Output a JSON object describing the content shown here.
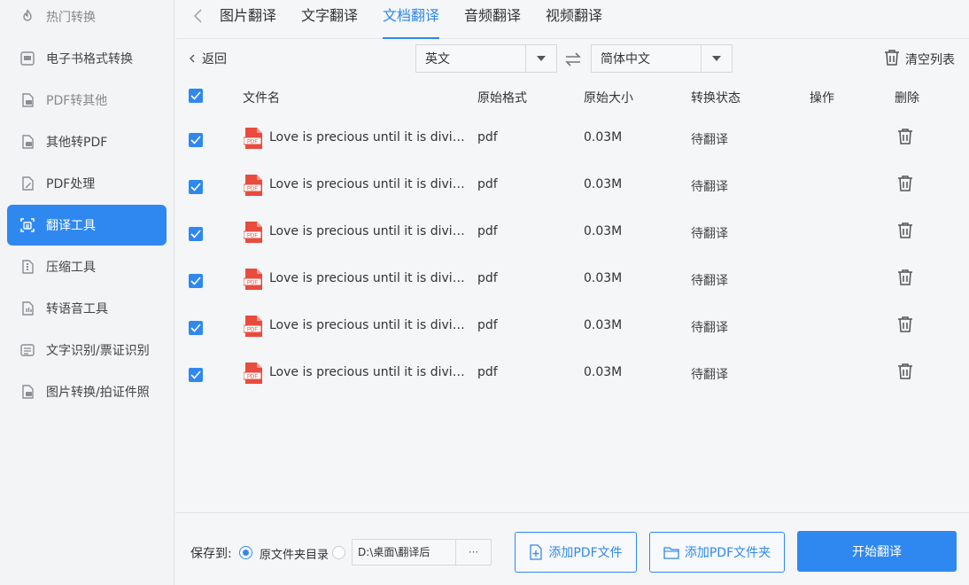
{
  "sidebar": {
    "items": [
      {
        "label": "热门转换",
        "icon": "flame-icon"
      },
      {
        "label": "电子书格式转换",
        "icon": "ebook-icon"
      },
      {
        "label": "PDF转其他",
        "icon": "pdf-convert-icon"
      },
      {
        "label": "其他转PDF",
        "icon": "to-pdf-icon"
      },
      {
        "label": "PDF处理",
        "icon": "pdf-edit-icon"
      },
      {
        "label": "翻译工具",
        "icon": "translate-icon",
        "active": true
      },
      {
        "label": "压缩工具",
        "icon": "compress-icon"
      },
      {
        "label": "转语音工具",
        "icon": "audio-icon"
      },
      {
        "label": "文字识别/票证识别",
        "icon": "ocr-icon"
      },
      {
        "label": "图片转换/拍证件照",
        "icon": "image-convert-icon"
      }
    ]
  },
  "tabs": [
    {
      "label": "图片翻译"
    },
    {
      "label": "文字翻译"
    },
    {
      "label": "文档翻译",
      "active": true
    },
    {
      "label": "音频翻译"
    },
    {
      "label": "视频翻译"
    }
  ],
  "toolbar": {
    "back_label": "返回",
    "source_lang": "英文",
    "target_lang": "简体中文",
    "clear_label": "清空列表"
  },
  "table": {
    "headers": {
      "name": "文件名",
      "format": "原始格式",
      "size": "原始大小",
      "status": "转换状态",
      "action": "操作",
      "delete": "删除"
    },
    "rows": [
      {
        "name": "Love is precious until it is divided...",
        "format": "pdf",
        "size": "0.03M",
        "status": "待翻译"
      },
      {
        "name": "Love is precious until it is divided...",
        "format": "pdf",
        "size": "0.03M",
        "status": "待翻译"
      },
      {
        "name": "Love is precious until it is divided...",
        "format": "pdf",
        "size": "0.03M",
        "status": "待翻译"
      },
      {
        "name": "Love is precious until it is divided...",
        "format": "pdf",
        "size": "0.03M",
        "status": "待翻译"
      },
      {
        "name": "Love is precious until it is divided...",
        "format": "pdf",
        "size": "0.03M",
        "status": "待翻译"
      },
      {
        "name": "Love is precious until it is divided...",
        "format": "pdf",
        "size": "0.03M",
        "status": "待翻译"
      }
    ]
  },
  "bottom": {
    "save_to_label": "保存到:",
    "option_original": "原文件夹目录",
    "path_value": "D:\\桌面\\翻译后",
    "browse_label": "···",
    "add_file_label": "添加PDF文件",
    "add_folder_label": "添加PDF文件夹",
    "start_label": "开始翻译"
  },
  "colors": {
    "accent": "#2f88f0",
    "pdf_red": "#e94b3c"
  }
}
